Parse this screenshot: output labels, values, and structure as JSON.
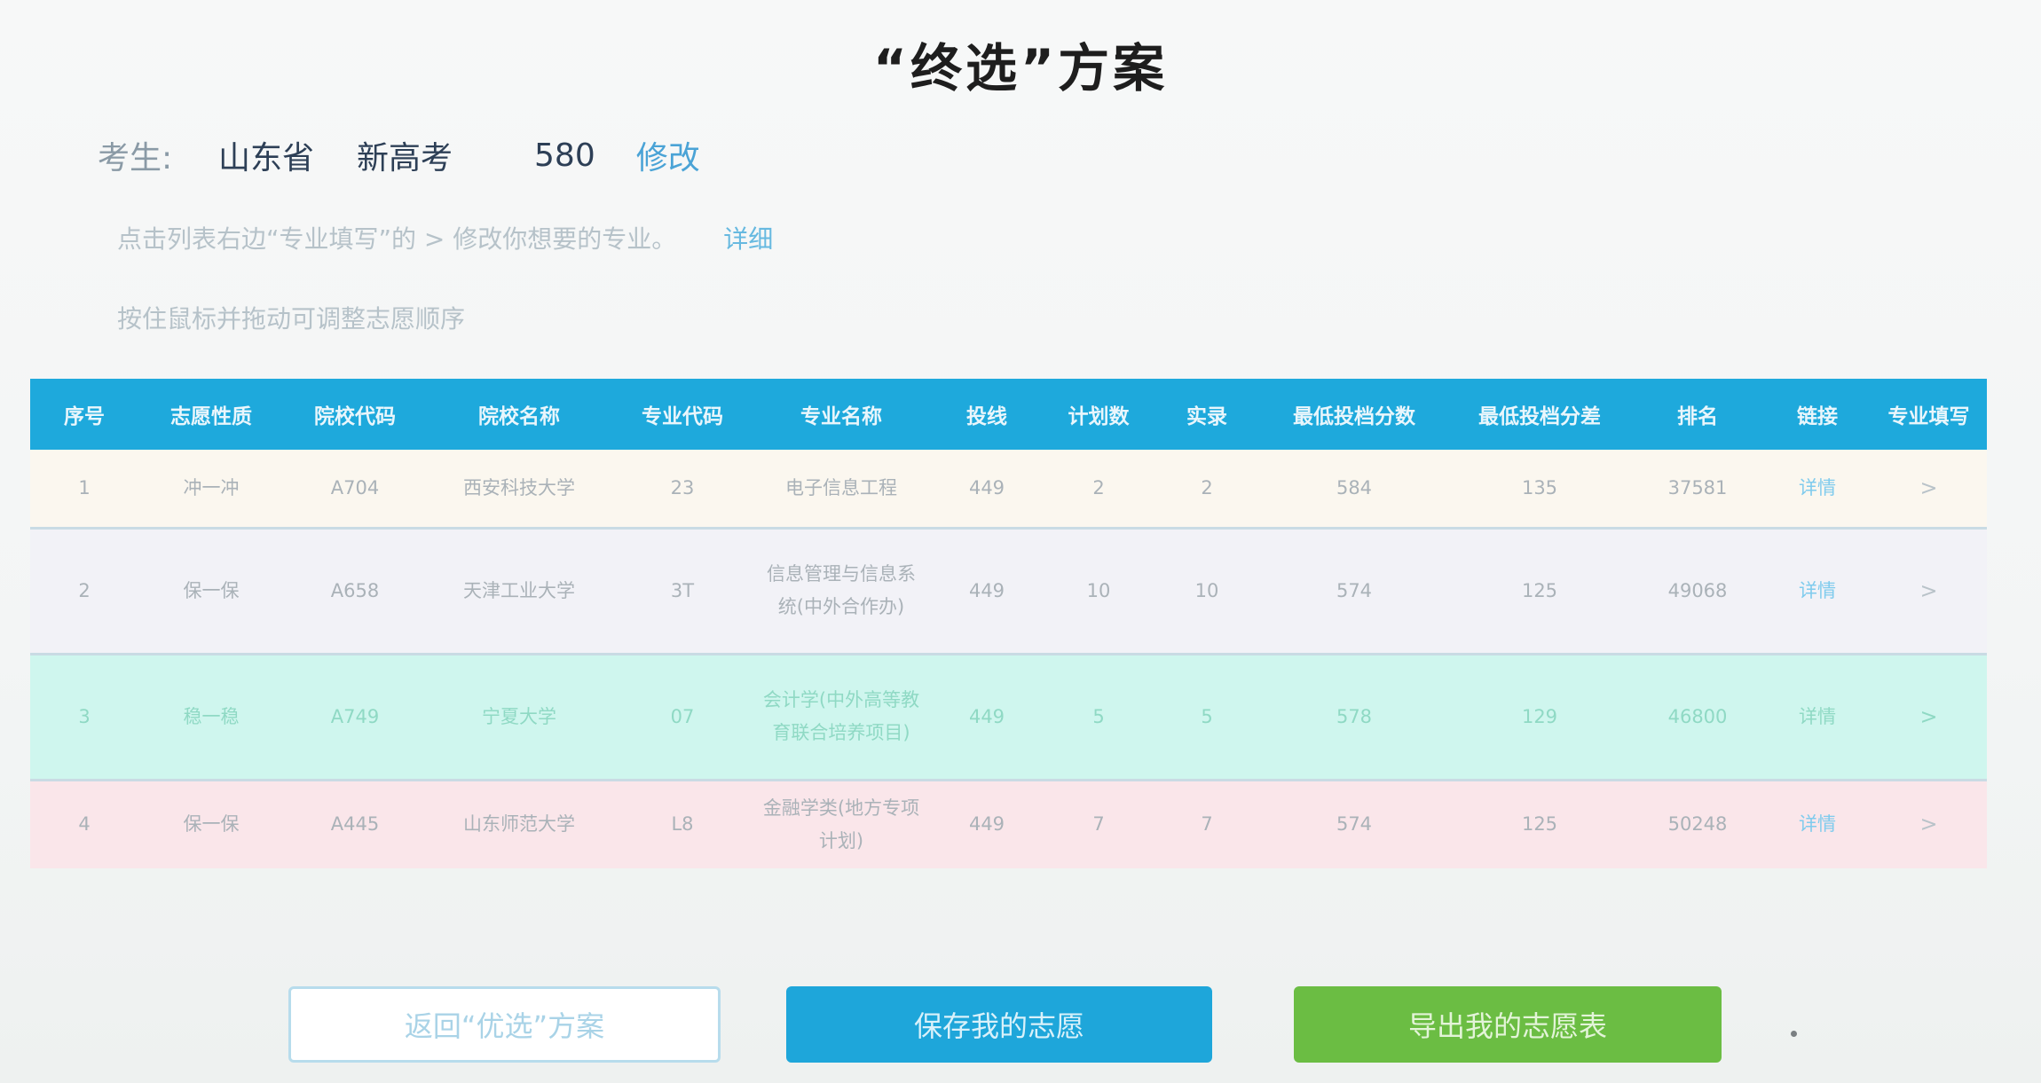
{
  "title": "“终选”方案",
  "candidate": {
    "label": "考生:",
    "province": "山东省",
    "mode": "新高考",
    "score": "580",
    "edit_label": "修改"
  },
  "tips": {
    "line1": "点击列表右边“专业填写”的 > 修改你想要的专业。",
    "detail_label": "详细",
    "line2": "按住鼠标并拖动可调整志愿顺序"
  },
  "table": {
    "headers": [
      "序号",
      "志愿性质",
      "院校代码",
      "院校名称",
      "专业代码",
      "专业名称",
      "投线",
      "计划数",
      "实录",
      "最低投档分数",
      "最低投档分差",
      "排名",
      "链接",
      "专业填写"
    ],
    "rows": [
      {
        "no": "1",
        "type": "冲一冲",
        "school_code": "A704",
        "school_name": "西安科技大学",
        "major_code": "23",
        "major_name": "电子信息工程",
        "line": "449",
        "plan": "2",
        "admitted": "2",
        "min_score": "584",
        "diff": "135",
        "rank": "37581",
        "link": "详情",
        "edit": ">"
      },
      {
        "no": "2",
        "type": "保一保",
        "school_code": "A658",
        "school_name": "天津工业大学",
        "major_code": "3T",
        "major_name": "信息管理与信息系统(中外合作办)",
        "line": "449",
        "plan": "10",
        "admitted": "10",
        "min_score": "574",
        "diff": "125",
        "rank": "49068",
        "link": "详情",
        "edit": ">"
      },
      {
        "no": "3",
        "type": "稳一稳",
        "school_code": "A749",
        "school_name": "宁夏大学",
        "major_code": "07",
        "major_name": "会计学(中外高等教育联合培养项目)",
        "line": "449",
        "plan": "5",
        "admitted": "5",
        "min_score": "578",
        "diff": "129",
        "rank": "46800",
        "link": "详情",
        "edit": ">"
      },
      {
        "no": "4",
        "type": "保一保",
        "school_code": "A445",
        "school_name": "山东师范大学",
        "major_code": "L8",
        "major_name": "金融学类(地方专项计划)",
        "line": "449",
        "plan": "7",
        "admitted": "7",
        "min_score": "574",
        "diff": "125",
        "rank": "50248",
        "link": "详情",
        "edit": ">"
      }
    ]
  },
  "buttons": {
    "back": "返回“优选”方案",
    "save": "保存我的志愿",
    "export": "导出我的志愿表"
  },
  "colors": {
    "header": "#1ea9dc",
    "save_button": "#1ea6da",
    "export_button": "#6bbd43",
    "row3_highlight": "#cff6ee",
    "row4_highlight": "#fae6ea"
  }
}
